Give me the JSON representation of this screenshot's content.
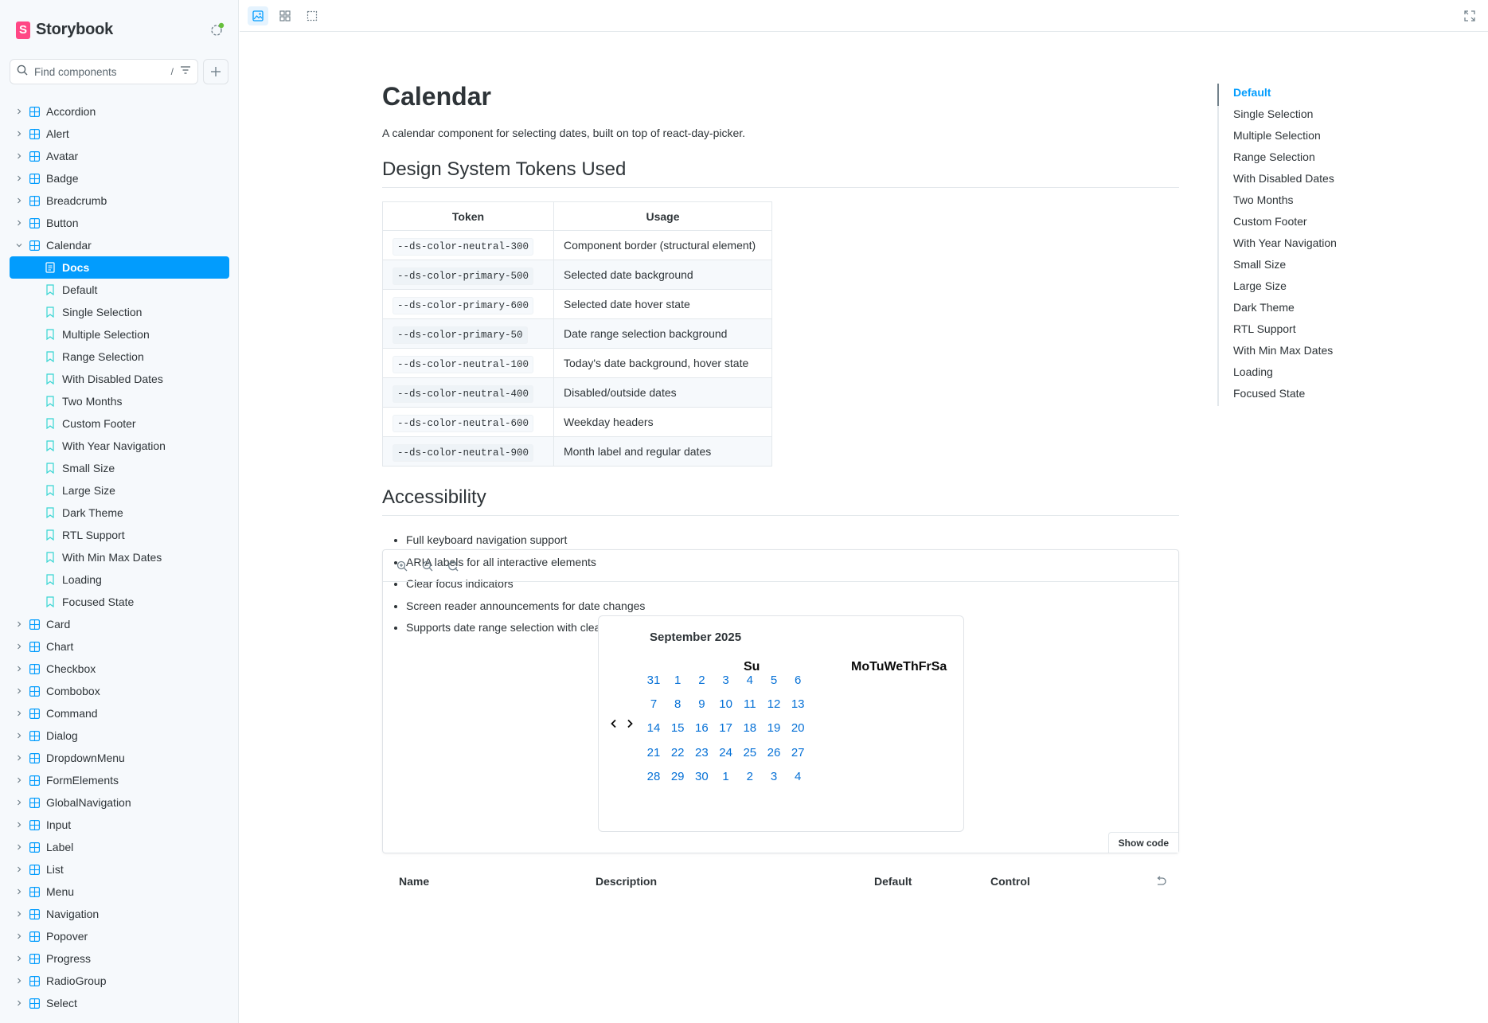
{
  "brand": {
    "name": "Storybook",
    "logo_letter": "S"
  },
  "search": {
    "placeholder": "Find components",
    "shortcut": "/"
  },
  "sidebar": {
    "groups_before": [
      "Accordion",
      "Alert",
      "Avatar",
      "Badge",
      "Breadcrumb",
      "Button"
    ],
    "open_group": "Calendar",
    "docs_label": "Docs",
    "stories": [
      "Default",
      "Single Selection",
      "Multiple Selection",
      "Range Selection",
      "With Disabled Dates",
      "Two Months",
      "Custom Footer",
      "With Year Navigation",
      "Small Size",
      "Large Size",
      "Dark Theme",
      "RTL Support",
      "With Min Max Dates",
      "Loading",
      "Focused State"
    ],
    "groups_after": [
      "Card",
      "Chart",
      "Checkbox",
      "Combobox",
      "Command",
      "Dialog",
      "DropdownMenu",
      "FormElements",
      "GlobalNavigation",
      "Input",
      "Label",
      "List",
      "Menu",
      "Navigation",
      "Popover",
      "Progress",
      "RadioGroup",
      "Select"
    ]
  },
  "doc": {
    "title": "Calendar",
    "description": "A calendar component for selecting dates, built on top of react-day-picker.",
    "tokens_heading": "Design System Tokens Used",
    "table_headers": [
      "Token",
      "Usage"
    ],
    "tokens": [
      {
        "token": "--ds-color-neutral-300",
        "usage": "Component border (structural element)"
      },
      {
        "token": "--ds-color-primary-500",
        "usage": "Selected date background"
      },
      {
        "token": "--ds-color-primary-600",
        "usage": "Selected date hover state"
      },
      {
        "token": "--ds-color-primary-50",
        "usage": "Date range selection background"
      },
      {
        "token": "--ds-color-neutral-100",
        "usage": "Today's date background, hover state"
      },
      {
        "token": "--ds-color-neutral-400",
        "usage": "Disabled/outside dates"
      },
      {
        "token": "--ds-color-neutral-600",
        "usage": "Weekday headers"
      },
      {
        "token": "--ds-color-neutral-900",
        "usage": "Month label and regular dates"
      }
    ],
    "a11y_heading": "Accessibility",
    "a11y_items": [
      "Full keyboard navigation support",
      "ARIA labels for all interactive elements",
      "Clear focus indicators",
      "Screen reader announcements for date changes",
      "Supports date range selection with clear visual indicators"
    ]
  },
  "calendar": {
    "month_label": "September 2025",
    "weekday_first": "Su",
    "weekday_rest": "MoTuWeThFrSa",
    "prev_symbol": "‹",
    "next_symbol": "›",
    "weeks": [
      [
        "31",
        "1",
        "2",
        "3",
        "4",
        "5",
        "6"
      ],
      [
        "7",
        "8",
        "9",
        "10",
        "11",
        "12",
        "13"
      ],
      [
        "14",
        "15",
        "16",
        "17",
        "18",
        "19",
        "20"
      ],
      [
        "21",
        "22",
        "23",
        "24",
        "25",
        "26",
        "27"
      ],
      [
        "28",
        "29",
        "30",
        "1",
        "2",
        "3",
        "4"
      ]
    ]
  },
  "canvas": {
    "show_code": "Show code"
  },
  "args_table": {
    "headers": [
      "Name",
      "Description",
      "Default",
      "Control"
    ]
  },
  "toc": [
    "Default",
    "Single Selection",
    "Multiple Selection",
    "Range Selection",
    "With Disabled Dates",
    "Two Months",
    "Custom Footer",
    "With Year Navigation",
    "Small Size",
    "Large Size",
    "Dark Theme",
    "RTL Support",
    "With Min Max Dates",
    "Loading",
    "Focused State"
  ],
  "colors": {
    "accent": "#029cfd",
    "brand": "#ff4785",
    "day_link": "#0570d6",
    "status": "#66bf3c"
  }
}
